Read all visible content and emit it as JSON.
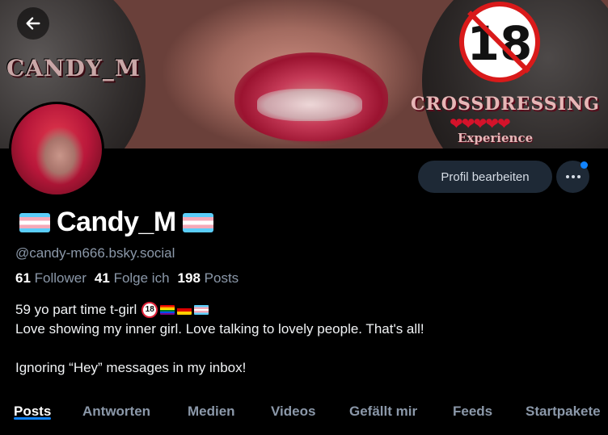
{
  "banner": {
    "title": "CANDY_M",
    "age_badge": "18",
    "subtitle": "CROSSDRESSING",
    "hearts": "❤❤❤❤❤",
    "tagline": "Experience"
  },
  "profile": {
    "display_name": "Candy_M",
    "handle": "@candy-m666.bsky.social",
    "stats": {
      "followers_count": "61",
      "followers_label": "Follower",
      "following_count": "41",
      "following_label": "Folge ich",
      "posts_count": "198",
      "posts_label": "Posts"
    },
    "bio": {
      "line1": "59 yo part time t-girl",
      "no18_badge": "18",
      "line2": "Love showing my inner girl. Love talking to lovely people. That's all!",
      "line3": "Ignoring “Hey” messages in my inbox!"
    }
  },
  "actions": {
    "edit_label": "Profil bearbeiten"
  },
  "tabs": [
    {
      "label": "Posts",
      "active": true
    },
    {
      "label": "Antworten",
      "active": false
    },
    {
      "label": "Medien",
      "active": false
    },
    {
      "label": "Videos",
      "active": false
    },
    {
      "label": "Gefällt mir",
      "active": false
    },
    {
      "label": "Feeds",
      "active": false
    },
    {
      "label": "Startpakete",
      "active": false
    }
  ],
  "colors": {
    "accent": "#1083fe",
    "muted_text": "#8b98a9",
    "button_bg": "#1e2936",
    "background": "#000000"
  },
  "icons": {
    "back": "arrow-left-icon",
    "more": "ellipsis-icon"
  }
}
